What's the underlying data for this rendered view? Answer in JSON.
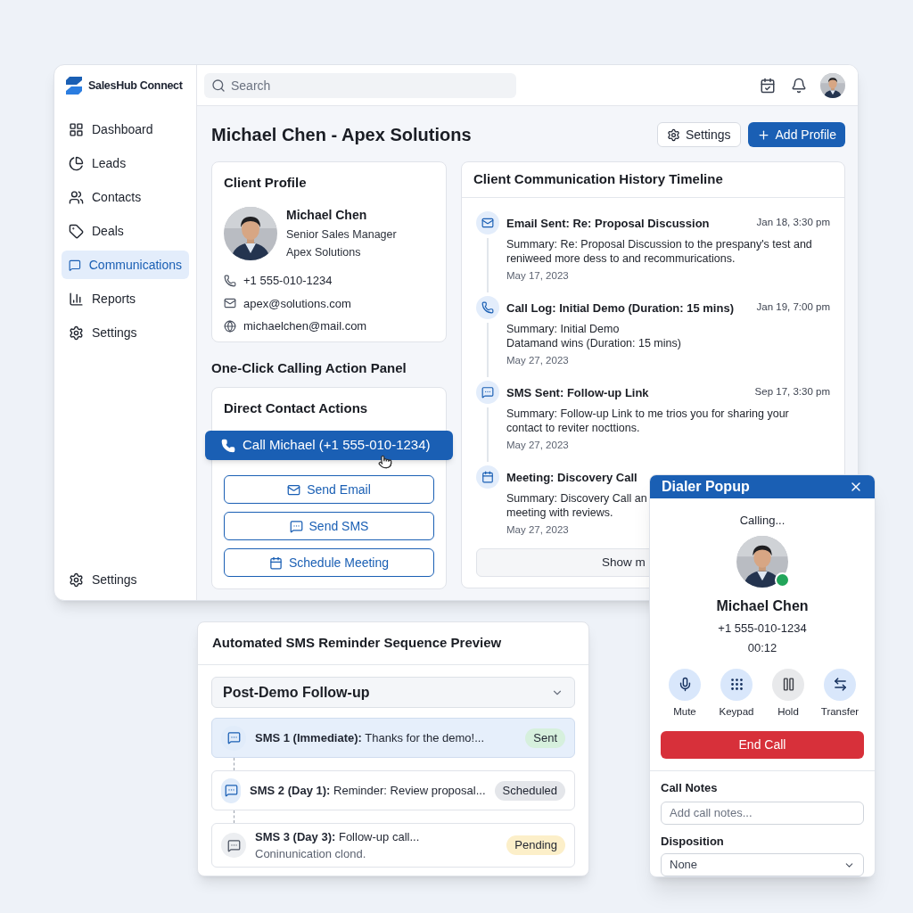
{
  "app": {
    "name": "SalesHub Connect"
  },
  "search": {
    "placeholder": "Search"
  },
  "nav": [
    {
      "kind": "dashboard",
      "label": "Dashboard",
      "selected": false
    },
    {
      "kind": "leads",
      "label": "Leads",
      "selected": false
    },
    {
      "kind": "contacts",
      "label": "Contacts",
      "selected": false
    },
    {
      "kind": "deals",
      "label": "Deals",
      "selected": false
    },
    {
      "kind": "communications",
      "label": "Communications",
      "selected": true
    },
    {
      "kind": "reports",
      "label": "Reports",
      "selected": false
    },
    {
      "kind": "settings",
      "label": "Settings",
      "selected": false
    }
  ],
  "nav_footer": {
    "kind": "settings",
    "label": "Settings"
  },
  "page": {
    "title": "Michael Chen - Apex Solutions",
    "buttons": [
      {
        "kind": "settings",
        "label": "Settings"
      },
      {
        "kind": "add",
        "label": "Add Profile"
      }
    ]
  },
  "client_profile": {
    "title": "Client Profile",
    "name": "Michael Chen",
    "role": "Senior Sales Manager",
    "company": "Apex Solutions",
    "contacts": [
      {
        "kind": "phone",
        "text": "+1 555-010-1234"
      },
      {
        "kind": "email",
        "text": "apex@solutions.com"
      },
      {
        "kind": "web",
        "text": "michaelchen@mail.com"
      }
    ]
  },
  "calling_panel": {
    "title": "One-Click Calling Action Panel",
    "card_title": "Direct Contact Actions",
    "actions": [
      {
        "kind": "call",
        "label": "Call Michael (+1 555-010-1234)",
        "primary": true
      },
      {
        "kind": "email",
        "label": "Send Email",
        "primary": false
      },
      {
        "kind": "sms",
        "label": "Send SMS",
        "primary": false
      },
      {
        "kind": "meeting",
        "label": "Schedule Meeting",
        "primary": false
      }
    ]
  },
  "timeline": {
    "title": "Client Communication History Timeline",
    "items": [
      {
        "kind": "email",
        "title": "Email Sent: Re: Proposal Discussion",
        "time": "Jan 18, 3:30 pm",
        "summary": "Summary: Re: Proposal Discussion to the prespany's test and\nreniweed more dess to and recommurications.",
        "date": "May 17, 2023"
      },
      {
        "kind": "call",
        "title": "Call Log: Initial Demo (Duration: 15 mins)",
        "time": "Jan 19, 7:00 pm",
        "summary": "Summary: Initial Demo\nDatamand wins (Duration: 15 mins)",
        "date": "May 27, 2023"
      },
      {
        "kind": "sms",
        "title": "SMS Sent: Follow-up Link",
        "time": "Sep 17, 3:30 pm",
        "summary": "Summary: Follow-up Link to me trios you for sharing your\ncontact to reviter nocttions.",
        "date": "May 27, 2023"
      },
      {
        "kind": "meeting",
        "title": "Meeting: Discovery Call",
        "summary": "Summary: Discovery Call an\nmeeting with reviews.",
        "date": "May 27, 2023"
      }
    ],
    "show_more": "Show m"
  },
  "sms_sequence": {
    "title": "Automated SMS Reminder Sequence Preview",
    "dropdown": "Post-Demo Follow-up",
    "steps": [
      {
        "label": "SMS 1 (Immediate):",
        "text": "Thanks for the demo!...",
        "status": "Sent",
        "color": "#d6f0dd",
        "selected": true,
        "dimmed": false
      },
      {
        "label": "SMS 2 (Day 1):",
        "text": "Reminder: Review proposal...",
        "status": "Scheduled",
        "color": "#e4e6ea",
        "selected": false,
        "dimmed": false
      },
      {
        "label": "SMS 3 (Day 3):",
        "text": "Follow-up call...",
        "subtext": "Coninunication clond.",
        "status": "Pending",
        "color": "#fcefc9",
        "selected": false,
        "dimmed": true
      }
    ]
  },
  "dialer": {
    "title": "Dialer Popup",
    "status": "Calling...",
    "online": true,
    "name": "Michael Chen",
    "phone": "+1 555-010-1234",
    "timer": "00:12",
    "controls": [
      {
        "kind": "mute",
        "label": "Mute",
        "active": true
      },
      {
        "kind": "keypad",
        "label": "Keypad",
        "active": true
      },
      {
        "kind": "hold",
        "label": "Hold",
        "active": false
      },
      {
        "kind": "transfer",
        "label": "Transfer",
        "active": true
      }
    ],
    "end_call": "End Call",
    "notes_label": "Call Notes",
    "notes_placeholder": "Add call notes...",
    "disposition_label": "Disposition",
    "disposition_value": "None"
  }
}
